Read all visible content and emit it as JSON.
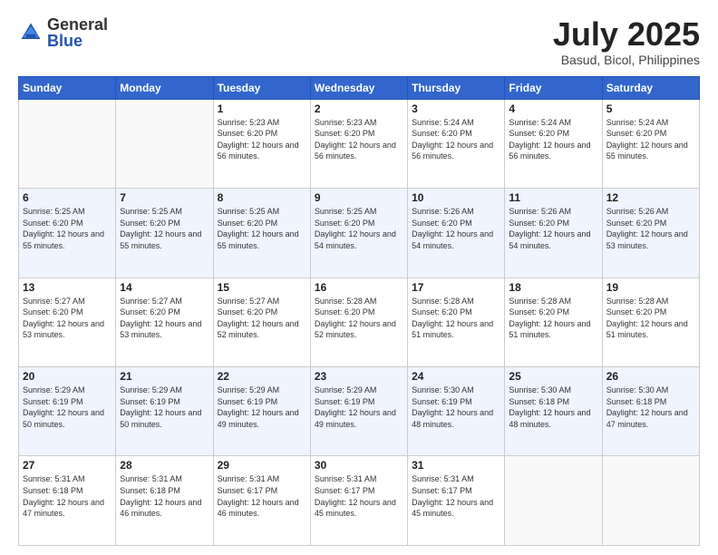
{
  "header": {
    "logo_general": "General",
    "logo_blue": "Blue",
    "month_title": "July 2025",
    "subtitle": "Basud, Bicol, Philippines"
  },
  "days_of_week": [
    "Sunday",
    "Monday",
    "Tuesday",
    "Wednesday",
    "Thursday",
    "Friday",
    "Saturday"
  ],
  "weeks": [
    [
      {
        "day": "",
        "info": ""
      },
      {
        "day": "",
        "info": ""
      },
      {
        "day": "1",
        "info": "Sunrise: 5:23 AM\nSunset: 6:20 PM\nDaylight: 12 hours and 56 minutes."
      },
      {
        "day": "2",
        "info": "Sunrise: 5:23 AM\nSunset: 6:20 PM\nDaylight: 12 hours and 56 minutes."
      },
      {
        "day": "3",
        "info": "Sunrise: 5:24 AM\nSunset: 6:20 PM\nDaylight: 12 hours and 56 minutes."
      },
      {
        "day": "4",
        "info": "Sunrise: 5:24 AM\nSunset: 6:20 PM\nDaylight: 12 hours and 56 minutes."
      },
      {
        "day": "5",
        "info": "Sunrise: 5:24 AM\nSunset: 6:20 PM\nDaylight: 12 hours and 55 minutes."
      }
    ],
    [
      {
        "day": "6",
        "info": "Sunrise: 5:25 AM\nSunset: 6:20 PM\nDaylight: 12 hours and 55 minutes."
      },
      {
        "day": "7",
        "info": "Sunrise: 5:25 AM\nSunset: 6:20 PM\nDaylight: 12 hours and 55 minutes."
      },
      {
        "day": "8",
        "info": "Sunrise: 5:25 AM\nSunset: 6:20 PM\nDaylight: 12 hours and 55 minutes."
      },
      {
        "day": "9",
        "info": "Sunrise: 5:25 AM\nSunset: 6:20 PM\nDaylight: 12 hours and 54 minutes."
      },
      {
        "day": "10",
        "info": "Sunrise: 5:26 AM\nSunset: 6:20 PM\nDaylight: 12 hours and 54 minutes."
      },
      {
        "day": "11",
        "info": "Sunrise: 5:26 AM\nSunset: 6:20 PM\nDaylight: 12 hours and 54 minutes."
      },
      {
        "day": "12",
        "info": "Sunrise: 5:26 AM\nSunset: 6:20 PM\nDaylight: 12 hours and 53 minutes."
      }
    ],
    [
      {
        "day": "13",
        "info": "Sunrise: 5:27 AM\nSunset: 6:20 PM\nDaylight: 12 hours and 53 minutes."
      },
      {
        "day": "14",
        "info": "Sunrise: 5:27 AM\nSunset: 6:20 PM\nDaylight: 12 hours and 53 minutes."
      },
      {
        "day": "15",
        "info": "Sunrise: 5:27 AM\nSunset: 6:20 PM\nDaylight: 12 hours and 52 minutes."
      },
      {
        "day": "16",
        "info": "Sunrise: 5:28 AM\nSunset: 6:20 PM\nDaylight: 12 hours and 52 minutes."
      },
      {
        "day": "17",
        "info": "Sunrise: 5:28 AM\nSunset: 6:20 PM\nDaylight: 12 hours and 51 minutes."
      },
      {
        "day": "18",
        "info": "Sunrise: 5:28 AM\nSunset: 6:20 PM\nDaylight: 12 hours and 51 minutes."
      },
      {
        "day": "19",
        "info": "Sunrise: 5:28 AM\nSunset: 6:20 PM\nDaylight: 12 hours and 51 minutes."
      }
    ],
    [
      {
        "day": "20",
        "info": "Sunrise: 5:29 AM\nSunset: 6:19 PM\nDaylight: 12 hours and 50 minutes."
      },
      {
        "day": "21",
        "info": "Sunrise: 5:29 AM\nSunset: 6:19 PM\nDaylight: 12 hours and 50 minutes."
      },
      {
        "day": "22",
        "info": "Sunrise: 5:29 AM\nSunset: 6:19 PM\nDaylight: 12 hours and 49 minutes."
      },
      {
        "day": "23",
        "info": "Sunrise: 5:29 AM\nSunset: 6:19 PM\nDaylight: 12 hours and 49 minutes."
      },
      {
        "day": "24",
        "info": "Sunrise: 5:30 AM\nSunset: 6:19 PM\nDaylight: 12 hours and 48 minutes."
      },
      {
        "day": "25",
        "info": "Sunrise: 5:30 AM\nSunset: 6:18 PM\nDaylight: 12 hours and 48 minutes."
      },
      {
        "day": "26",
        "info": "Sunrise: 5:30 AM\nSunset: 6:18 PM\nDaylight: 12 hours and 47 minutes."
      }
    ],
    [
      {
        "day": "27",
        "info": "Sunrise: 5:31 AM\nSunset: 6:18 PM\nDaylight: 12 hours and 47 minutes."
      },
      {
        "day": "28",
        "info": "Sunrise: 5:31 AM\nSunset: 6:18 PM\nDaylight: 12 hours and 46 minutes."
      },
      {
        "day": "29",
        "info": "Sunrise: 5:31 AM\nSunset: 6:17 PM\nDaylight: 12 hours and 46 minutes."
      },
      {
        "day": "30",
        "info": "Sunrise: 5:31 AM\nSunset: 6:17 PM\nDaylight: 12 hours and 45 minutes."
      },
      {
        "day": "31",
        "info": "Sunrise: 5:31 AM\nSunset: 6:17 PM\nDaylight: 12 hours and 45 minutes."
      },
      {
        "day": "",
        "info": ""
      },
      {
        "day": "",
        "info": ""
      }
    ]
  ]
}
